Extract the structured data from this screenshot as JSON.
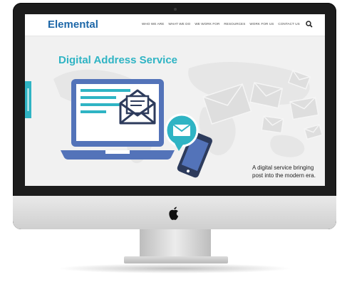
{
  "header": {
    "brand": "Elemental",
    "nav_items": [
      "WHO WE ARE",
      "WHAT WE DO",
      "WE WORK FOR",
      "RESOURCES",
      "WORK FOR US",
      "CONTACT US"
    ]
  },
  "hero": {
    "title": "Digital Address Service",
    "tagline_line1": "A digital service bringing",
    "tagline_line2": "post into the modern era."
  },
  "colors": {
    "brand": "#1d67a8",
    "accent": "#2fb4c4",
    "laptop": "#5373b9"
  },
  "icons": [
    "search-icon",
    "envelope-icon",
    "chat-bubble-icon",
    "phone-icon",
    "laptop-icon",
    "apple-logo-icon"
  ]
}
